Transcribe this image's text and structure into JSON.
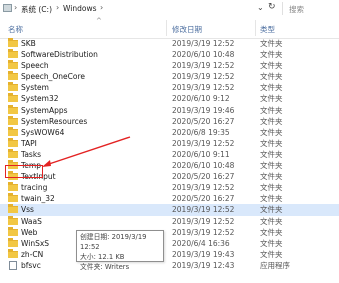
{
  "address": {
    "crumbs": [
      "系统 (C:)",
      "Windows"
    ],
    "search_placeholder": "搜索"
  },
  "columns": {
    "name": "名称",
    "date": "修改日期",
    "type": "类型"
  },
  "files": [
    {
      "name": "SKB",
      "date": "2019/3/19 12:52",
      "type": "文件夹",
      "kind": "folder"
    },
    {
      "name": "SoftwareDistribution",
      "date": "2020/6/10 10:48",
      "type": "文件夹",
      "kind": "folder"
    },
    {
      "name": "Speech",
      "date": "2019/3/19 12:52",
      "type": "文件夹",
      "kind": "folder"
    },
    {
      "name": "Speech_OneCore",
      "date": "2019/3/19 12:52",
      "type": "文件夹",
      "kind": "folder"
    },
    {
      "name": "System",
      "date": "2019/3/19 12:52",
      "type": "文件夹",
      "kind": "folder"
    },
    {
      "name": "System32",
      "date": "2020/6/10 9:12",
      "type": "文件夹",
      "kind": "folder"
    },
    {
      "name": "SystemApps",
      "date": "2019/3/19 19:46",
      "type": "文件夹",
      "kind": "folder"
    },
    {
      "name": "SystemResources",
      "date": "2020/5/20 16:27",
      "type": "文件夹",
      "kind": "folder"
    },
    {
      "name": "SysWOW64",
      "date": "2020/6/8 19:35",
      "type": "文件夹",
      "kind": "folder"
    },
    {
      "name": "TAPI",
      "date": "2019/3/19 12:52",
      "type": "文件夹",
      "kind": "folder"
    },
    {
      "name": "Tasks",
      "date": "2020/6/10 9:11",
      "type": "文件夹",
      "kind": "folder"
    },
    {
      "name": "Temp",
      "date": "2020/6/10 10:48",
      "type": "文件夹",
      "kind": "folder"
    },
    {
      "name": "TextInput",
      "date": "2020/5/20 16:27",
      "type": "文件夹",
      "kind": "folder"
    },
    {
      "name": "tracing",
      "date": "2019/3/19 12:52",
      "type": "文件夹",
      "kind": "folder"
    },
    {
      "name": "twain_32",
      "date": "2020/5/20 16:27",
      "type": "文件夹",
      "kind": "folder"
    },
    {
      "name": "Vss",
      "date": "2019/3/19 12:52",
      "type": "文件夹",
      "kind": "folder",
      "selected": true
    },
    {
      "name": "WaaS",
      "date": "2019/3/19 12:52",
      "type": "文件夹",
      "kind": "folder"
    },
    {
      "name": "Web",
      "date": "2019/3/19 12:52",
      "type": "文件夹",
      "kind": "folder"
    },
    {
      "name": "WinSxS",
      "date": "2020/6/4 16:36",
      "type": "文件夹",
      "kind": "folder"
    },
    {
      "name": "zh-CN",
      "date": "2019/3/19 19:43",
      "type": "文件夹",
      "kind": "folder"
    },
    {
      "name": "bfsvc",
      "date": "2019/3/19 12:43",
      "type": "应用程序",
      "kind": "file"
    }
  ],
  "tooltip": {
    "line1": "创建日期: 2019/3/19 12:52",
    "line2": "大小: 12.1 KB",
    "line3": "文件夹: Writers"
  },
  "colors": {
    "highlight": "#e32222",
    "selected_row": "#d9e8fb",
    "folder": "#f2c744"
  }
}
